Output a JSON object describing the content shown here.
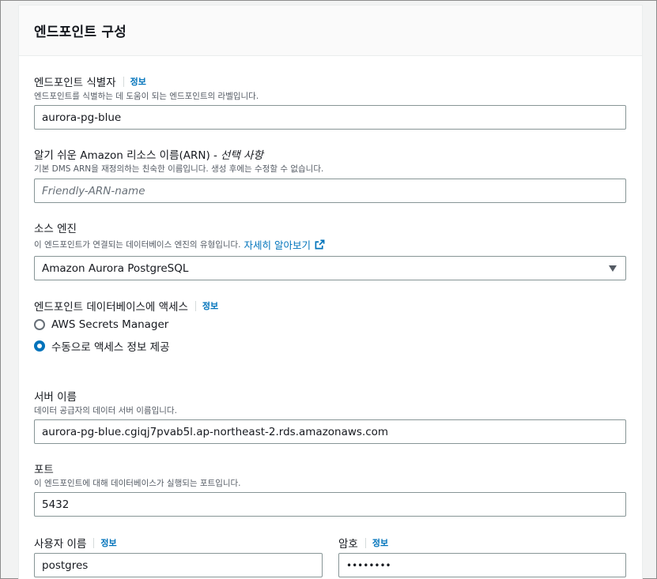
{
  "panel": {
    "title": "엔드포인트 구성"
  },
  "endpoint_id": {
    "label": "엔드포인트 식별자",
    "info": "정보",
    "description": "엔드포인트를 식별하는 데 도움이 되는 엔드포인트의 라벨입니다.",
    "value": "aurora-pg-blue"
  },
  "arn": {
    "label": "알기 쉬운 Amazon 리소스 이름(ARN) -",
    "optional": "선택 사항",
    "description": "기본 DMS ARN을 재정의하는 친숙한 이름입니다. 생성 후에는 수정할 수 없습니다.",
    "placeholder": "Friendly-ARN-name"
  },
  "source_engine": {
    "label": "소스 엔진",
    "description": "이 엔드포인트가 연결되는 데이터베이스 엔진의 유형입니다.",
    "learn_more": "자세히 알아보기",
    "selected": "Amazon Aurora PostgreSQL"
  },
  "db_access": {
    "label": "엔드포인트 데이터베이스에 액세스",
    "info": "정보",
    "options": [
      {
        "label": "AWS Secrets Manager",
        "checked": false
      },
      {
        "label": "수동으로 액세스 정보 제공",
        "checked": true
      }
    ]
  },
  "server_name": {
    "label": "서버 이름",
    "description": "데이터 공급자의 데이터 서버 이름입니다.",
    "value": "aurora-pg-blue.cgiqj7pvab5l.ap-northeast-2.rds.amazonaws.com"
  },
  "port": {
    "label": "포트",
    "description": "이 엔드포인트에 대해 데이터베이스가 실행되는 포트입니다.",
    "value": "5432"
  },
  "username": {
    "label": "사용자 이름",
    "info": "정보",
    "value": "postgres"
  },
  "password": {
    "label": "암호",
    "info": "정보",
    "value": "••••••••"
  },
  "icons": {
    "external_link": "external-link-icon",
    "dropdown": "caret-down-icon"
  },
  "colors": {
    "link": "#0073bb",
    "radio_checked": "#0073bb",
    "border": "#879596"
  }
}
